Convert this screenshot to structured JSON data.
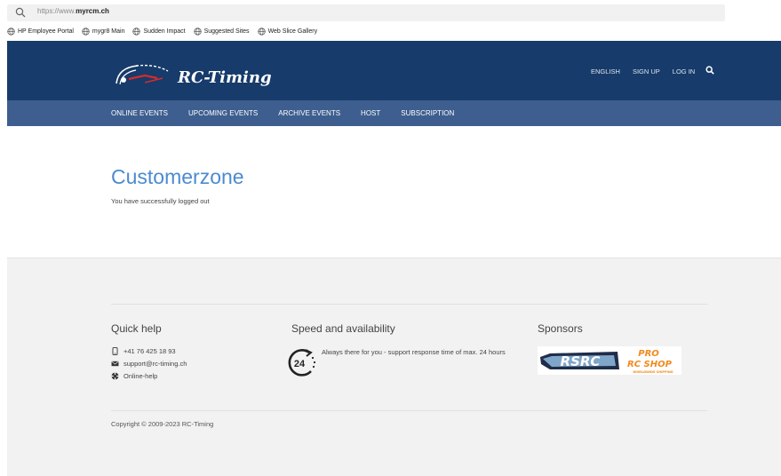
{
  "browser": {
    "url_prefix": "https://www.",
    "url_domain": "myrcm.ch",
    "favorites": [
      {
        "label": "HP Employee Portal"
      },
      {
        "label": "mygr8 Main"
      },
      {
        "label": "Sudden Impact"
      },
      {
        "label": "Suggested Sites"
      },
      {
        "label": "Web Slice Gallery"
      }
    ]
  },
  "header": {
    "logo_text": "RC-Timing",
    "top_links": [
      "ENGLISH",
      "SIGN UP",
      "LOG IN"
    ]
  },
  "nav": {
    "items": [
      "ONLINE EVENTS",
      "UPCOMING EVENTS",
      "ARCHIVE EVENTS",
      "HOST",
      "SUBSCRIPTION"
    ]
  },
  "main": {
    "title": "Customerzone",
    "message": "You have successfully logged out"
  },
  "footer": {
    "quick_help": {
      "heading": "Quick help",
      "phone": "+41 76 425 18 93",
      "email": "support@rc-timing.ch",
      "online_help": "Online-help"
    },
    "speed": {
      "heading": "Speed and availability",
      "icon_text": "24",
      "text": "Always there for you - support response time of max. 24 hours"
    },
    "sponsors": {
      "heading": "Sponsors",
      "logo_left": "RSRC",
      "logo_right_line1": "PRO",
      "logo_right_line2": "RC SHOP",
      "logo_right_line3": "WORLDWIDE SHIPPING"
    },
    "copyright": "Copyright © 2009-2023 RC-Timing"
  },
  "colors": {
    "header_bg": "#173b6a",
    "subnav_bg": "#3d5e8f",
    "title_blue": "#4b8bd0",
    "footer_bg": "#f2f2f2",
    "logo_accent_red": "#d62b2b",
    "sponsor_orange": "#f08a1c"
  }
}
